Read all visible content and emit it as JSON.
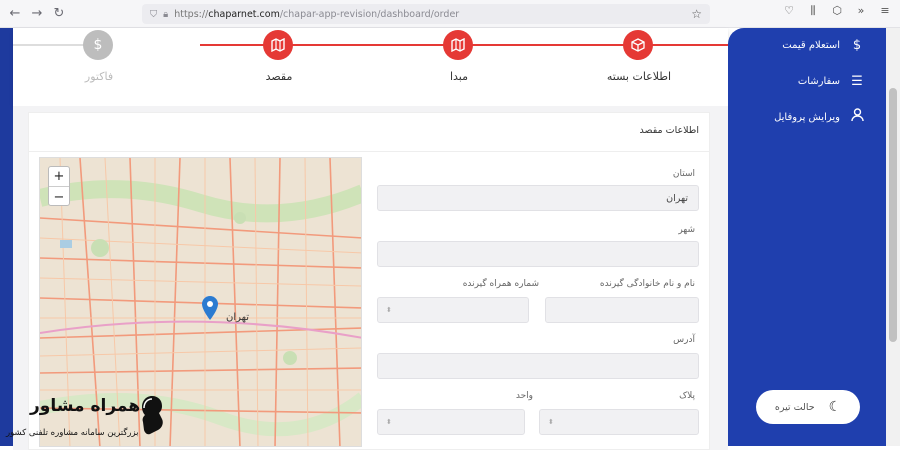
{
  "browser": {
    "url_prefix": "https://",
    "url_host": "chaparnet.com",
    "url_path": "/chapar-app-revision/dashboard/order"
  },
  "sidebar": {
    "items": [
      {
        "label": "استعلام قیمت",
        "icon": "dollar-icon"
      },
      {
        "label": "سفارشات",
        "icon": "list-icon"
      },
      {
        "label": "ویرایش پروفایل",
        "icon": "user-icon"
      }
    ],
    "dark_mode": "حالت تیره"
  },
  "steps": [
    {
      "label": "اطلاعات بسته",
      "state": "done",
      "icon": "box-icon"
    },
    {
      "label": "مبدا",
      "state": "done",
      "icon": "map-icon"
    },
    {
      "label": "مقصد",
      "state": "active",
      "icon": "map-icon"
    },
    {
      "label": "فاکتور",
      "state": "pending",
      "icon": "dollar-icon"
    }
  ],
  "form": {
    "title": "اطلاعات مقصد",
    "province_label": "استان",
    "province_value": "تهران",
    "city_label": "شهر",
    "city_value": "",
    "recipient_name_label": "نام و نام خانوادگی گیرنده",
    "recipient_mobile_label": "شماره همراه گیرنده",
    "address_label": "آدرس",
    "plaque_label": "پلاک",
    "unit_label": "واحد"
  },
  "map": {
    "city_label": "تهران"
  },
  "watermark": {
    "brand": "همراه مشاور",
    "tagline": "بزرگترین سامانه مشاوره تلفنی کشور"
  },
  "colors": {
    "accent": "#e53935",
    "sidebar": "#1f3fae",
    "pending": "#bdbdbd"
  }
}
